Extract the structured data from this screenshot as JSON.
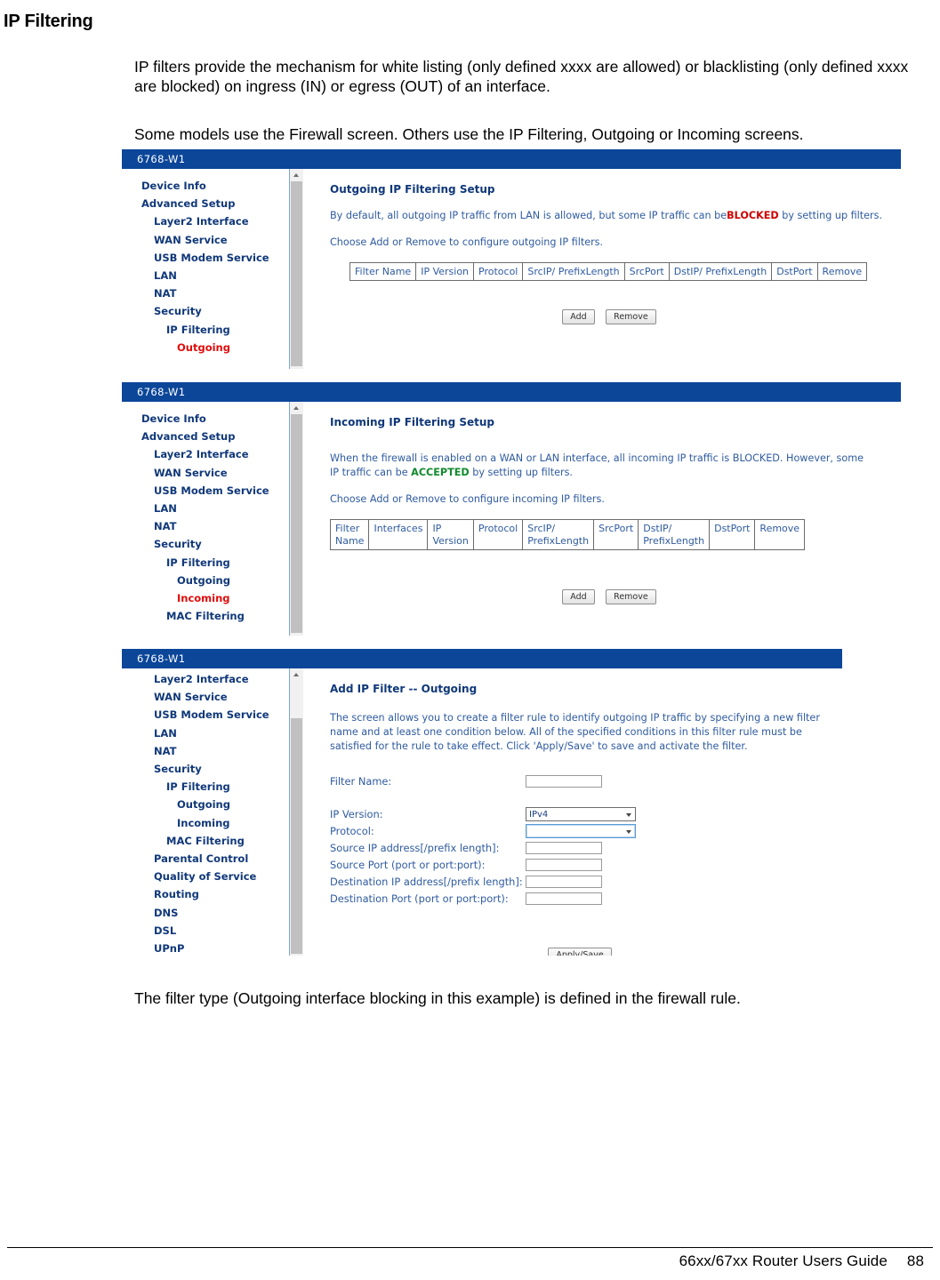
{
  "document": {
    "title": "IP Filtering",
    "paragraph_1": "IP filters provide the mechanism for white listing (only defined xxxx are allowed) or blacklisting (only defined xxxx are blocked) on ingress (IN) or egress (OUT) of an interface.",
    "paragraph_2": "Some models use the Firewall screen. Others use the IP Filtering, Outgoing or Incoming screens.",
    "caption": "The filter type (Outgoing interface blocking in this example) is defined in the firewall rule.",
    "footer_title": "66xx/67xx Router Users Guide",
    "footer_page": "88"
  },
  "colors": {
    "titlebar": "#0b4699",
    "nav_link": "#10387a",
    "nav_active": "#e20b0b",
    "content_text": "#2f5ba0",
    "blocked_red": "#d00000",
    "accepted_green": "#118a2e"
  },
  "screenshot_outgoing": {
    "window_title": "6768-W1",
    "nav": [
      {
        "label": "Device Info",
        "level": 1,
        "active": false
      },
      {
        "label": "Advanced Setup",
        "level": 1,
        "active": false
      },
      {
        "label": "Layer2 Interface",
        "level": 2,
        "active": false
      },
      {
        "label": "WAN Service",
        "level": 2,
        "active": false
      },
      {
        "label": "USB Modem Service",
        "level": 2,
        "active": false
      },
      {
        "label": "LAN",
        "level": 2,
        "active": false
      },
      {
        "label": "NAT",
        "level": 2,
        "active": false
      },
      {
        "label": "Security",
        "level": 2,
        "active": false
      },
      {
        "label": "IP Filtering",
        "level": 3,
        "active": false
      },
      {
        "label": "Outgoing",
        "level": 4,
        "active": true
      }
    ],
    "heading": "Outgoing IP Filtering Setup",
    "intro_before": "By default, all outgoing IP traffic from LAN is allowed, but some IP traffic can be",
    "intro_highlight": "BLOCKED",
    "intro_after": " by setting up filters.",
    "instruction": "Choose Add or Remove to configure outgoing IP filters.",
    "table_headers": [
      "Filter Name",
      "IP Version",
      "Protocol",
      "SrcIP/ PrefixLength",
      "SrcPort",
      "DstIP/ PrefixLength",
      "DstPort",
      "Remove"
    ],
    "buttons": {
      "add": "Add",
      "remove": "Remove"
    }
  },
  "screenshot_incoming": {
    "window_title": "6768-W1",
    "nav": [
      {
        "label": "Device Info",
        "level": 1,
        "active": false
      },
      {
        "label": "Advanced Setup",
        "level": 1,
        "active": false
      },
      {
        "label": "Layer2 Interface",
        "level": 2,
        "active": false
      },
      {
        "label": "WAN Service",
        "level": 2,
        "active": false
      },
      {
        "label": "USB Modem Service",
        "level": 2,
        "active": false
      },
      {
        "label": "LAN",
        "level": 2,
        "active": false
      },
      {
        "label": "NAT",
        "level": 2,
        "active": false
      },
      {
        "label": "Security",
        "level": 2,
        "active": false
      },
      {
        "label": "IP Filtering",
        "level": 3,
        "active": false
      },
      {
        "label": "Outgoing",
        "level": 4,
        "active": false
      },
      {
        "label": "Incoming",
        "level": 4,
        "active": true
      },
      {
        "label": "MAC Filtering",
        "level": 3,
        "active": false
      }
    ],
    "heading": "Incoming IP Filtering Setup",
    "intro_before": "When the firewall is enabled on a WAN or LAN interface, all incoming IP traffic is BLOCKED. However, some IP traffic can be ",
    "intro_highlight": "ACCEPTED",
    "intro_after": " by setting up filters.",
    "instruction": "Choose Add or Remove to configure incoming IP filters.",
    "table_headers": [
      {
        "line1": "Filter",
        "line2": "Name"
      },
      {
        "line1": "Interfaces",
        "line2": ""
      },
      {
        "line1": "IP",
        "line2": "Version"
      },
      {
        "line1": "Protocol",
        "line2": ""
      },
      {
        "line1": "SrcIP/",
        "line2": "PrefixLength"
      },
      {
        "line1": "SrcPort",
        "line2": ""
      },
      {
        "line1": "DstIP/",
        "line2": "PrefixLength"
      },
      {
        "line1": "DstPort",
        "line2": ""
      },
      {
        "line1": "Remove",
        "line2": ""
      }
    ],
    "buttons": {
      "add": "Add",
      "remove": "Remove"
    }
  },
  "screenshot_add_filter": {
    "window_title": "6768-W1",
    "nav": [
      {
        "label": "Layer2 Interface",
        "level": 2,
        "active": false
      },
      {
        "label": "WAN Service",
        "level": 2,
        "active": false
      },
      {
        "label": "USB Modem Service",
        "level": 2,
        "active": false
      },
      {
        "label": "LAN",
        "level": 2,
        "active": false
      },
      {
        "label": "NAT",
        "level": 2,
        "active": false
      },
      {
        "label": "Security",
        "level": 2,
        "active": false
      },
      {
        "label": "IP Filtering",
        "level": 3,
        "active": false
      },
      {
        "label": "Outgoing",
        "level": 4,
        "active": false
      },
      {
        "label": "Incoming",
        "level": 4,
        "active": false
      },
      {
        "label": "MAC Filtering",
        "level": 3,
        "active": false
      },
      {
        "label": "Parental Control",
        "level": 2,
        "active": false
      },
      {
        "label": "Quality of Service",
        "level": 2,
        "active": false
      },
      {
        "label": "Routing",
        "level": 2,
        "active": false
      },
      {
        "label": "DNS",
        "level": 2,
        "active": false
      },
      {
        "label": "DSL",
        "level": 2,
        "active": false
      },
      {
        "label": "UPnP",
        "level": 2,
        "active": false
      }
    ],
    "heading": "Add IP Filter -- Outgoing",
    "description": "The screen allows you to create a filter rule to identify outgoing IP traffic by specifying a new filter name and at least one condition below. All of the specified conditions in this filter rule must be satisfied for the rule to take effect. Click 'Apply/Save' to save and activate the filter.",
    "fields": {
      "filter_name": {
        "label": "Filter Name:",
        "value": ""
      },
      "ip_version": {
        "label": "IP Version:",
        "value": "IPv4"
      },
      "protocol": {
        "label": "Protocol:",
        "value": ""
      },
      "source_ip": {
        "label": "Source IP address[/prefix length]:",
        "value": ""
      },
      "source_port": {
        "label": "Source Port (port or port:port):",
        "value": ""
      },
      "dest_ip": {
        "label": "Destination IP address[/prefix length]:",
        "value": ""
      },
      "dest_port": {
        "label": "Destination Port (port or port:port):",
        "value": ""
      }
    },
    "buttons": {
      "apply_save": "Apply/Save"
    }
  }
}
